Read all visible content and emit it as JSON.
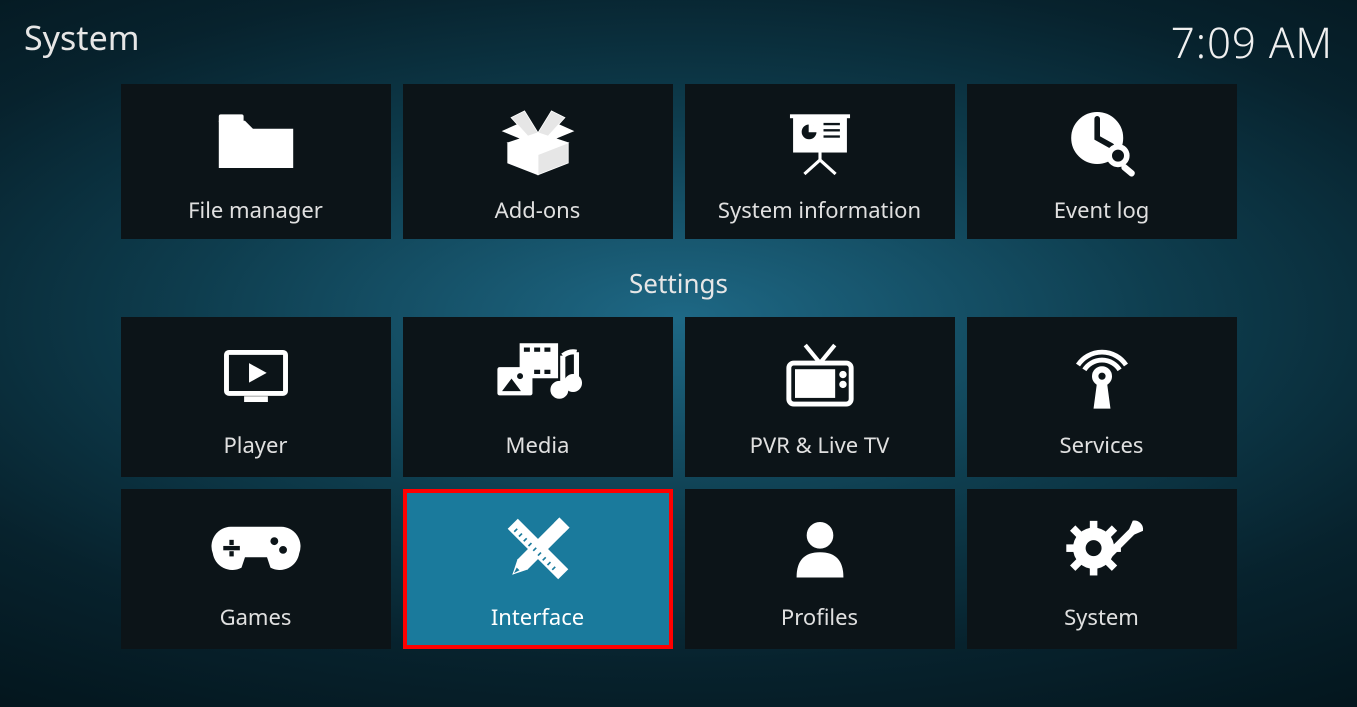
{
  "header": {
    "title": "System",
    "clock": "7:09 AM"
  },
  "section_label": "Settings",
  "row1": [
    {
      "label": "File manager",
      "icon": "folder",
      "selected": false
    },
    {
      "label": "Add-ons",
      "icon": "box",
      "selected": false
    },
    {
      "label": "System information",
      "icon": "presentation",
      "selected": false
    },
    {
      "label": "Event log",
      "icon": "clock-search",
      "selected": false
    }
  ],
  "row2": [
    {
      "label": "Player",
      "icon": "play-monitor",
      "selected": false
    },
    {
      "label": "Media",
      "icon": "media-mix",
      "selected": false
    },
    {
      "label": "PVR & Live TV",
      "icon": "tv",
      "selected": false
    },
    {
      "label": "Services",
      "icon": "antenna",
      "selected": false
    }
  ],
  "row3": [
    {
      "label": "Games",
      "icon": "gamepad",
      "selected": false
    },
    {
      "label": "Interface",
      "icon": "pencil-ruler",
      "selected": true
    },
    {
      "label": "Profiles",
      "icon": "person",
      "selected": false
    },
    {
      "label": "System",
      "icon": "gear-wrench",
      "selected": false
    }
  ]
}
